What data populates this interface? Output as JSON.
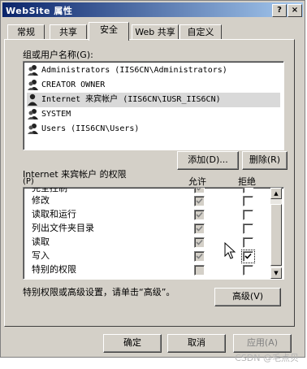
{
  "window": {
    "title": "WebSite 属性",
    "help_button": "?",
    "close_button": "×"
  },
  "tabs": [
    {
      "label": "常规",
      "active": false
    },
    {
      "label": "共享",
      "active": false
    },
    {
      "label": "安全",
      "active": true
    },
    {
      "label": "Web 共享",
      "active": false
    },
    {
      "label": "自定义",
      "active": false
    }
  ],
  "users_section": {
    "label": "组或用户名称(G):",
    "users": [
      {
        "name": "Administrators (IIS6CN\\Administrators)",
        "selected": false
      },
      {
        "name": "CREATOR OWNER",
        "selected": false
      },
      {
        "name": "Internet 来宾帐户 (IIS6CN\\IUSR_IIS6CN)",
        "selected": true
      },
      {
        "name": "SYSTEM",
        "selected": false
      },
      {
        "name": "Users (IIS6CN\\Users)",
        "selected": false
      }
    ],
    "add_button": "添加(D)...",
    "remove_button": "删除(R)"
  },
  "permissions_section": {
    "label": "Internet 来宾帐户 的权限",
    "label_shortcut": "(P)",
    "allow_header": "允许",
    "deny_header": "拒绝",
    "rows": [
      {
        "name": "完全控制",
        "allow": "grayed-checked",
        "deny": "unchecked"
      },
      {
        "name": "修改",
        "allow": "grayed-checked",
        "deny": "unchecked"
      },
      {
        "name": "读取和运行",
        "allow": "grayed-checked",
        "deny": "unchecked"
      },
      {
        "name": "列出文件夹目录",
        "allow": "grayed-checked",
        "deny": "unchecked"
      },
      {
        "name": "读取",
        "allow": "grayed-checked",
        "deny": "unchecked"
      },
      {
        "name": "写入",
        "allow": "grayed-checked",
        "deny": "checked"
      },
      {
        "name": "特别的权限",
        "allow": "grayed",
        "deny": "unchecked"
      }
    ]
  },
  "advanced_section": {
    "text": "特别权限或高级设置，请单击“高级”。",
    "button": "高级(V)"
  },
  "dialog_buttons": {
    "ok": "确定",
    "cancel": "取消",
    "apply": "应用(A)"
  },
  "watermark": "CSDN @毛点贝"
}
